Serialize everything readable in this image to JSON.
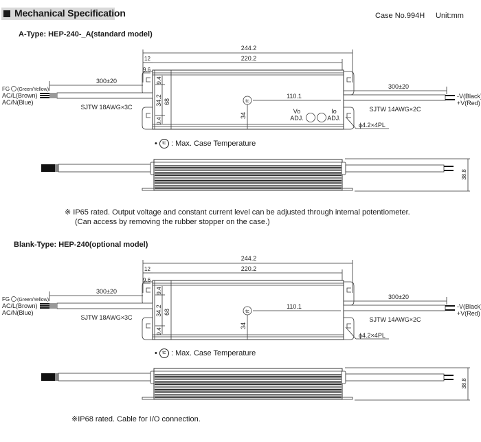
{
  "header": {
    "title": "Mechanical Specification",
    "case_no": "Case No.994H",
    "unit": "Unit:mm"
  },
  "sections": [
    {
      "title": "A-Type: HEP-240-_A(standard model)",
      "top_view": {
        "overall_length": "244.2",
        "body_length": "220.2",
        "flange_offset": "12",
        "end_offset": "9.6",
        "mount_edge_top": "9.4",
        "mount_spacing": "34.2",
        "mount_edge_bottom": "9.4",
        "body_width": "68",
        "tc_x": "110.1",
        "tc_y": "34",
        "tc_symbol": "tc",
        "vo_adj": [
          "Vo",
          "ADJ."
        ],
        "io_adj": [
          "Io",
          "ADJ."
        ],
        "show_adj": true,
        "input_cable": {
          "length": "300±20",
          "spec": "SJTW 18AWG×3C",
          "wires": [
            "FG (Green/Yellow)",
            "AC/L(Brown)",
            "AC/N(Blue)"
          ],
          "fg_prefix": "FG",
          "fg_color": "(Green/Yellow)",
          "ac_l": "AC/L(Brown)",
          "ac_n": "AC/N(Blue)"
        },
        "output_cable": {
          "length": "300±20",
          "spec": "SJTW 14AWG×2C",
          "neg": "-V(Black)",
          "pos": "+V(Red)"
        },
        "mount_holes": "ϕ4.2×4PL"
      },
      "legend": ": Max. Case Temperature",
      "side_view": {
        "height": "38.8"
      },
      "notes": [
        "※ IP65 rated. Output voltage and constant current level can be adjusted through internal potentiometer.",
        "(Can access by removing the rubber stopper on the case.)"
      ]
    },
    {
      "title": "Blank-Type: HEP-240(optional model)",
      "top_view": {
        "overall_length": "244.2",
        "body_length": "220.2",
        "flange_offset": "12",
        "end_offset": "9.6",
        "mount_edge_top": "9.4",
        "mount_spacing": "34.2",
        "mount_edge_bottom": "9.4",
        "body_width": "68",
        "tc_x": "110.1",
        "tc_y": "34",
        "tc_symbol": "tc",
        "show_adj": false,
        "input_cable": {
          "length": "300±20",
          "spec": "SJTW 18AWG×3C",
          "fg_prefix": "FG",
          "fg_color": "(Green/Yellow)",
          "ac_l": "AC/L(Brown)",
          "ac_n": "AC/N(Blue)"
        },
        "output_cable": {
          "length": "300±20",
          "spec": "SJTW 14AWG×2C",
          "neg": "-V(Black)",
          "pos": "+V(Red)"
        },
        "mount_holes": "ϕ4.2×4PL"
      },
      "legend": ": Max. Case Temperature",
      "side_view": {
        "height": "38.8"
      },
      "notes": [
        "※IP68 rated. Cable for I/O connection."
      ]
    }
  ]
}
